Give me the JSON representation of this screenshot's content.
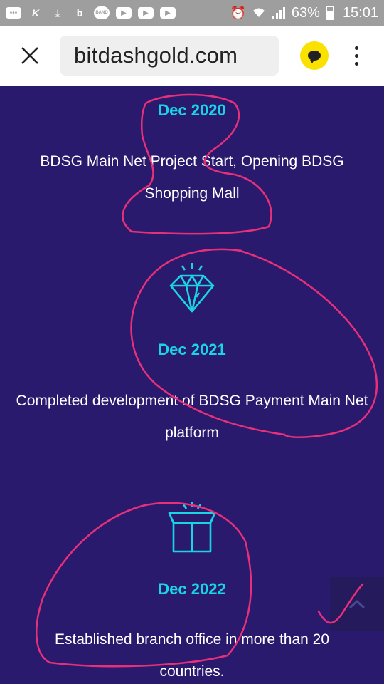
{
  "status_bar": {
    "battery": "63%",
    "time": "15:01",
    "band_label": "BAND",
    "icons": [
      "chat-bubble-icon",
      "k-icon",
      "download-icon",
      "b-app-icon",
      "band-icon",
      "youtube-icon",
      "youtube-icon",
      "youtube-icon",
      "alarm-icon",
      "wifi-icon",
      "signal-icon",
      "battery-icon"
    ]
  },
  "browser": {
    "url": "bitdashgold.com",
    "close_icon": "close-icon",
    "talk_icon": "kakaotalk-icon",
    "menu_icon": "more-vert-icon"
  },
  "timeline": [
    {
      "date": "Dec 2020",
      "text_lines": [
        "BDSG Main Net Project Start, Opening BDSG",
        "Shopping Mall"
      ],
      "icon": ""
    },
    {
      "date": "Dec 2021",
      "text_lines": [
        "Completed development of BDSG Payment Main Net",
        "platform"
      ],
      "icon": "diamond-icon"
    },
    {
      "date": "Dec 2022",
      "text_lines": [
        "Established branch office in more than 20",
        "countries."
      ],
      "icon": "gift-box-icon"
    }
  ],
  "colors": {
    "background": "#2a1a6e",
    "accent": "#19d3e6",
    "annotation": "#e8307a",
    "status_bar": "#9e9e9e"
  }
}
